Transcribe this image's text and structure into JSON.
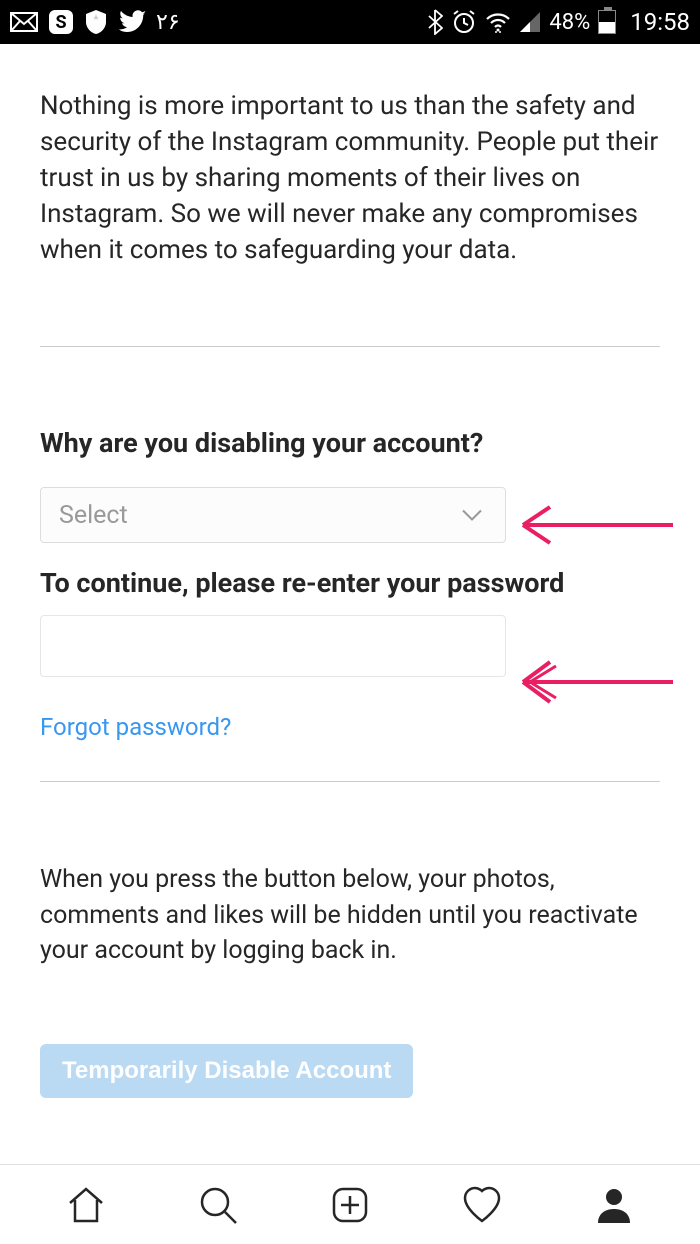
{
  "status_bar": {
    "notification_count": "۲۶",
    "battery_percent": "48%",
    "time": "19:58"
  },
  "main": {
    "intro": "Nothing is more important to us than the safety and security of the Instagram community. People put their trust in us by sharing moments of their lives on Instagram. So we will never make any compromises when it comes to safeguarding your data.",
    "why_heading": "Why are you disabling your account?",
    "select_placeholder": "Select",
    "reenter_heading": "To continue, please re-enter your password",
    "password_value": "",
    "forgot_link": "Forgot password?",
    "disclaimer": "When you press the button below, your photos, comments and likes will be hidden until you reactivate your account by logging back in.",
    "disable_button": "Temporarily Disable Account"
  }
}
